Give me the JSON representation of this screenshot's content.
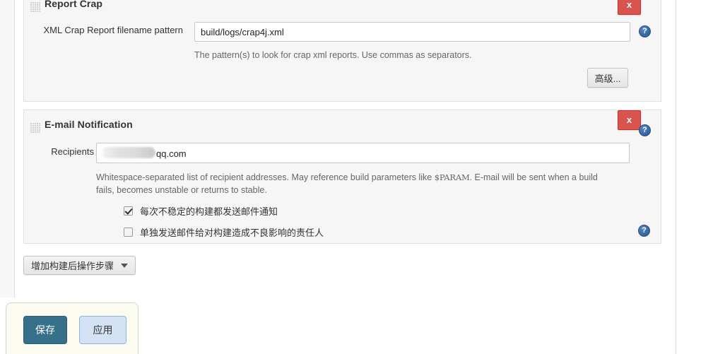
{
  "sections": [
    {
      "id": "report_crap",
      "title": "Report Crap",
      "close_label": "x",
      "help_label": "?",
      "field_label": "XML Crap Report filename pattern",
      "field_value": "build/logs/crap4j.xml",
      "field_placeholder": "",
      "description": "The pattern(s) to look for crap xml reports. Use commas as separators.",
      "advanced_label": "高级..."
    },
    {
      "id": "email_notification",
      "title": "E-mail Notification",
      "close_label": "x",
      "help_label": "?",
      "field_label": "Recipients",
      "field_value_visible": "qq.com",
      "field_value_redacted": true,
      "description_line1": "Whitespace-separated list of recipient addresses. May reference build parameters like ",
      "description_param": "$PARAM",
      "description_line1_tail": ". E-mail will be sent when a build",
      "description_line2": "fails, becomes unstable or returns to stable.",
      "checkboxes": [
        {
          "label": "每次不稳定的构建都发送邮件通知",
          "checked": true,
          "has_help": false
        },
        {
          "label": "单独发送邮件给对构建造成不良影响的责任人",
          "checked": false,
          "has_help": true,
          "help_label": "?"
        }
      ]
    }
  ],
  "add_post_build_step": {
    "label": "增加构建后操作步骤",
    "caret": "▾"
  },
  "bottom_bar": {
    "save_label": "保存",
    "apply_label": "应用"
  },
  "colors": {
    "close_red": "#d9534f",
    "help_blue": "#3a6ba8",
    "save_teal": "#36708a",
    "apply_blue": "#d3e3f5",
    "panel_bg": "#f6f6f6",
    "bottom_bar_bg": "#fbfbf2",
    "bottom_bar_border": "#c6ddc6"
  }
}
